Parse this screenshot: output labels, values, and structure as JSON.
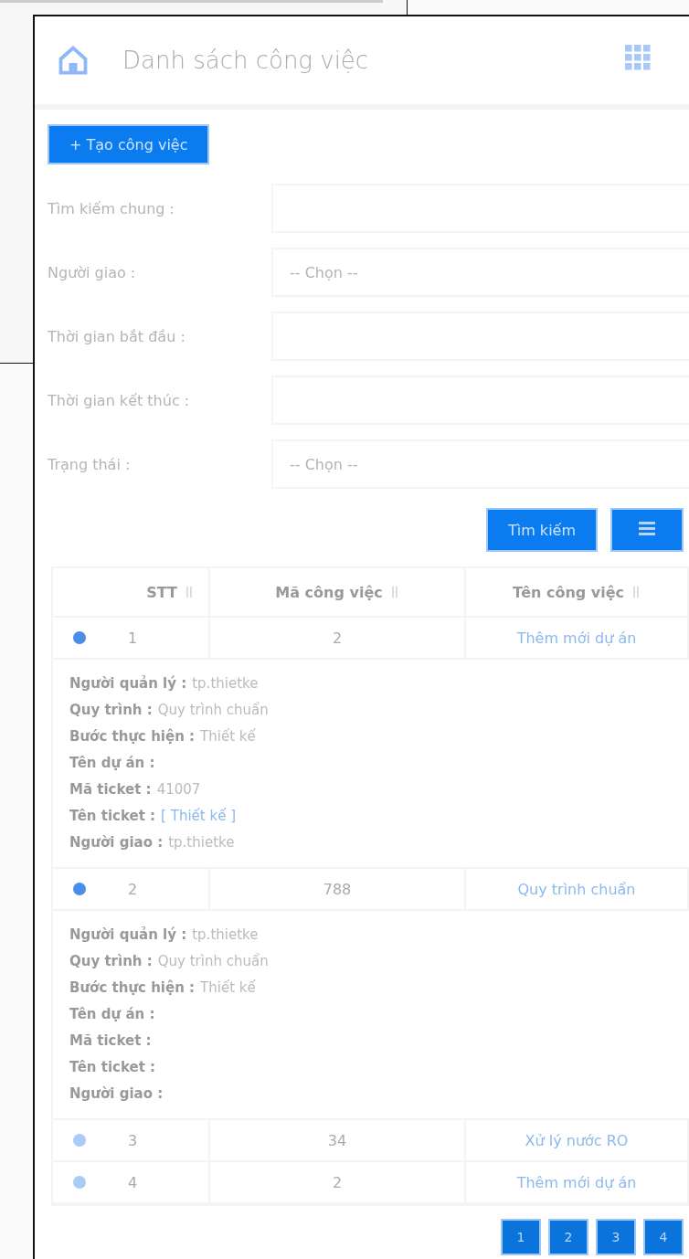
{
  "page_title": "Danh sách công việc",
  "create_button": "+ Tạo công việc",
  "filters": [
    {
      "label": "Tìm kiếm chung :",
      "kind": "text"
    },
    {
      "label": "Người giao :",
      "kind": "select",
      "placeholder": "-- Chọn --"
    },
    {
      "label": "Thời gian bắt đầu :",
      "kind": "text"
    },
    {
      "label": "Thời gian kết thúc :",
      "kind": "text"
    },
    {
      "label": "Trạng thái :",
      "kind": "select",
      "placeholder": "-- Chọn --"
    }
  ],
  "search_button": "Tìm kiếm",
  "table": {
    "columns": [
      "STT",
      "Mã công việc",
      "Tên công việc"
    ],
    "rows": [
      {
        "stt": "1",
        "code": "2",
        "name": "Thêm mới dự án",
        "expanded": true,
        "details": [
          {
            "label": "Người quản lý :",
            "value": "tp.thietke",
            "kind": "text"
          },
          {
            "label": "Quy trình :",
            "value": "Quy trình chuẩn",
            "kind": "text"
          },
          {
            "label": "Bước thực hiện :",
            "value": "Thiết kế",
            "kind": "text"
          },
          {
            "label": "Tên dự án :",
            "kind": "text"
          },
          {
            "label": "Mã ticket :",
            "value": "41007",
            "kind": "text"
          },
          {
            "label": "Tên ticket :",
            "value": "[ Thiết kế ]",
            "kind": "link"
          },
          {
            "label": "Người giao :",
            "value": "tp.thietke",
            "kind": "text"
          }
        ]
      },
      {
        "stt": "2",
        "code": "788",
        "name": "Quy trình chuẩn",
        "expanded": true,
        "details": [
          {
            "label": "Người quản lý :",
            "value": "tp.thietke",
            "kind": "text"
          },
          {
            "label": "Quy trình :",
            "value": "Quy trình chuẩn",
            "kind": "text"
          },
          {
            "label": "Bước thực hiện :",
            "value": "Thiết kế",
            "kind": "text"
          },
          {
            "label": "Tên dự án :",
            "kind": "text"
          },
          {
            "label": "Mã ticket :",
            "kind": "text"
          },
          {
            "label": "Tên ticket :",
            "kind": "text"
          },
          {
            "label": "Người giao :",
            "kind": "text"
          }
        ]
      },
      {
        "stt": "3",
        "code": "34",
        "name": "Xử lý nước RO",
        "expanded": false
      },
      {
        "stt": "4",
        "code": "2",
        "name": "Thêm mới dự án",
        "expanded": false
      }
    ]
  },
  "pagination": [
    "1",
    "2",
    "3",
    "4"
  ]
}
